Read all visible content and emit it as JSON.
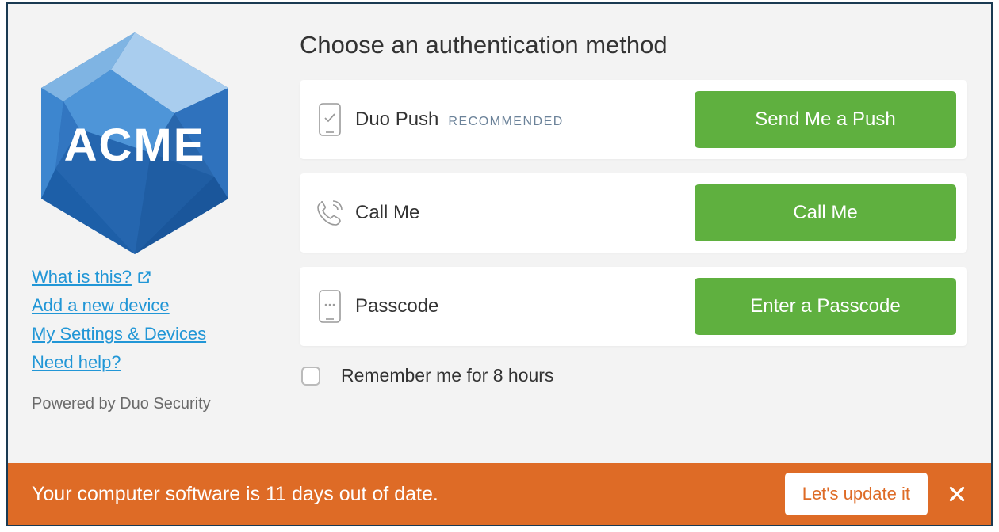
{
  "sidebar": {
    "logo_text": "ACME",
    "links": {
      "what": "What is this?",
      "add_device": "Add a new device",
      "settings": "My Settings & Devices",
      "help": "Need help?"
    },
    "powered": "Powered by Duo Security"
  },
  "main": {
    "heading": "Choose an authentication method",
    "methods": [
      {
        "icon": "phone-check-icon",
        "label": "Duo Push",
        "badge": "RECOMMENDED",
        "button": "Send Me a Push"
      },
      {
        "icon": "phone-call-icon",
        "label": "Call Me",
        "badge": "",
        "button": "Call Me"
      },
      {
        "icon": "passcode-icon",
        "label": "Passcode",
        "badge": "",
        "button": "Enter a Passcode"
      }
    ],
    "remember_label": "Remember me for 8 hours"
  },
  "banner": {
    "message": "Your computer software is 11 days out of date.",
    "button": "Let's update it"
  },
  "colors": {
    "accent_green": "#5fb03f",
    "link_blue": "#2196d6",
    "banner_orange": "#de6b26",
    "border_dark": "#1a3a52"
  }
}
